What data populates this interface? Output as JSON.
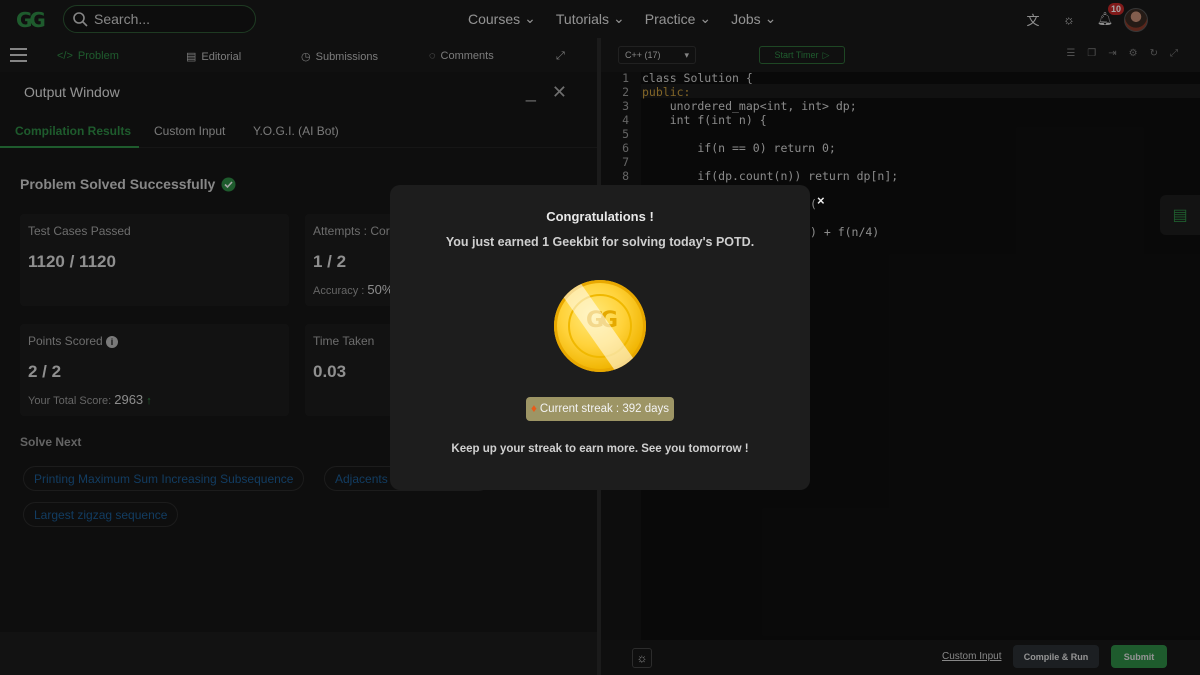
{
  "nav": {
    "logo": "GG",
    "search_placeholder": "Search...",
    "links": [
      "Courses",
      "Tutorials",
      "Practice",
      "Jobs"
    ],
    "notification_count": "10"
  },
  "left_tabs": [
    "Problem",
    "Editorial",
    "Submissions",
    "Comments"
  ],
  "output": {
    "title": "Output Window",
    "tabs": [
      "Compilation Results",
      "Custom Input",
      "Y.O.G.I. (AI Bot)"
    ],
    "status": "Problem Solved Successfully",
    "cards": {
      "tests_label": "Test Cases Passed",
      "tests_value": "1120 / 1120",
      "attempts_label": "Attempts : Corr",
      "attempts_value": "1 / 2",
      "accuracy_label": "Accuracy :",
      "accuracy_value": "50%",
      "points_label": "Points Scored",
      "points_value": "2 / 2",
      "total_label": "Your Total Score:",
      "total_value": "2963",
      "time_label": "Time Taken",
      "time_value": "0.03"
    },
    "solve_next_title": "Solve Next",
    "solve_next": [
      "Printing Maximum Sum Increasing Subsequence",
      "Adjacents",
      "Largest zigzag sequence"
    ]
  },
  "editor": {
    "language": "C++ (17)",
    "timer_label": "Start Timer",
    "lines": [
      {
        "n": "1",
        "code": "class Solution {"
      },
      {
        "n": "2",
        "code": "public:"
      },
      {
        "n": "3",
        "code": "    unordered_map<int, int> dp;"
      },
      {
        "n": "4",
        "code": "    int f(int n) {"
      },
      {
        "n": "5",
        "code": ""
      },
      {
        "n": "6",
        "code": "        if(n == 0) return 0;"
      },
      {
        "n": "7",
        "code": ""
      },
      {
        "n": "8",
        "code": "        if(dp.count(n)) return dp[n];"
      }
    ],
    "partial_line_9": "(",
    "partial_line_11": ") + f(n/4)",
    "custom_input": "Custom Input",
    "compile_run": "Compile & Run",
    "submit": "Submit"
  },
  "modal": {
    "title": "Congratulations !",
    "message": "You just earned 1 Geekbit for solving today's POTD.",
    "coin_logo": "GG",
    "streak": "Current streak : 392 days",
    "footer": "Keep up your streak to earn more. See you tomorrow !",
    "close": "×"
  },
  "colors": {
    "accent": "#2f8d46",
    "link": "#1c5d96",
    "streak_bg": "#9d9565"
  }
}
